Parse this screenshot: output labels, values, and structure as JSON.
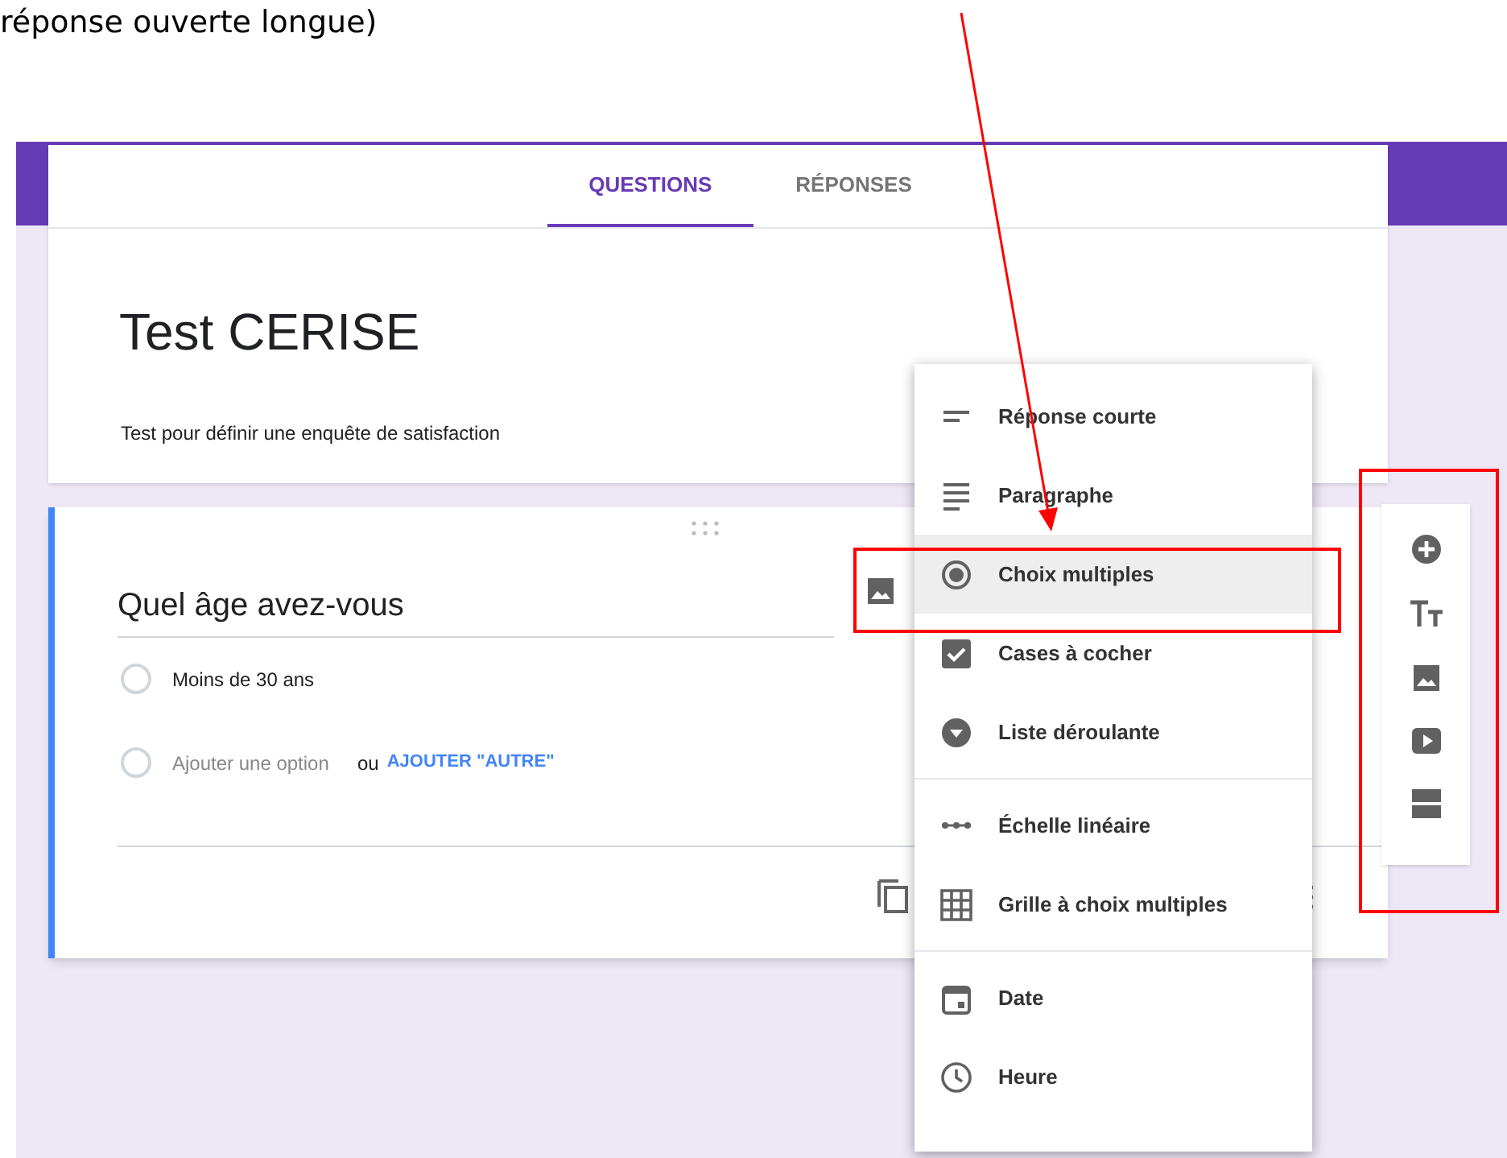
{
  "annotation_text": "réponse ouverte longue)",
  "tabs": [
    {
      "label": "QUESTIONS",
      "selected": true
    },
    {
      "label": "RÉPONSES",
      "selected": false
    }
  ],
  "form": {
    "title": "Test CERISE",
    "description": "Test pour définir une enquête de satisfaction"
  },
  "question": {
    "title": "Quel âge avez-vous",
    "options": [
      {
        "label": "Moins de 30 ans",
        "checked": false
      }
    ],
    "add_option": {
      "checked": false,
      "placeholder": "Ajouter une option",
      "separator": "ou",
      "link": "AJOUTER \"AUTRE\""
    }
  },
  "type_menu": {
    "groups": [
      [
        {
          "kind": "short",
          "label": "Réponse courte",
          "selected": false
        },
        {
          "kind": "paragraph",
          "label": "Paragraphe",
          "selected": false
        },
        {
          "kind": "radio",
          "label": "Choix multiples",
          "selected": true
        },
        {
          "kind": "checkbox",
          "label": "Cases à cocher",
          "selected": false
        },
        {
          "kind": "dropdown",
          "label": "Liste déroulante",
          "selected": false
        }
      ],
      [
        {
          "kind": "scale",
          "label": "Échelle linéaire",
          "selected": false
        },
        {
          "kind": "grid",
          "label": "Grille à choix multiples",
          "selected": false
        }
      ],
      [
        {
          "kind": "date",
          "label": "Date",
          "selected": false
        },
        {
          "kind": "time",
          "label": "Heure",
          "selected": false
        }
      ]
    ]
  }
}
